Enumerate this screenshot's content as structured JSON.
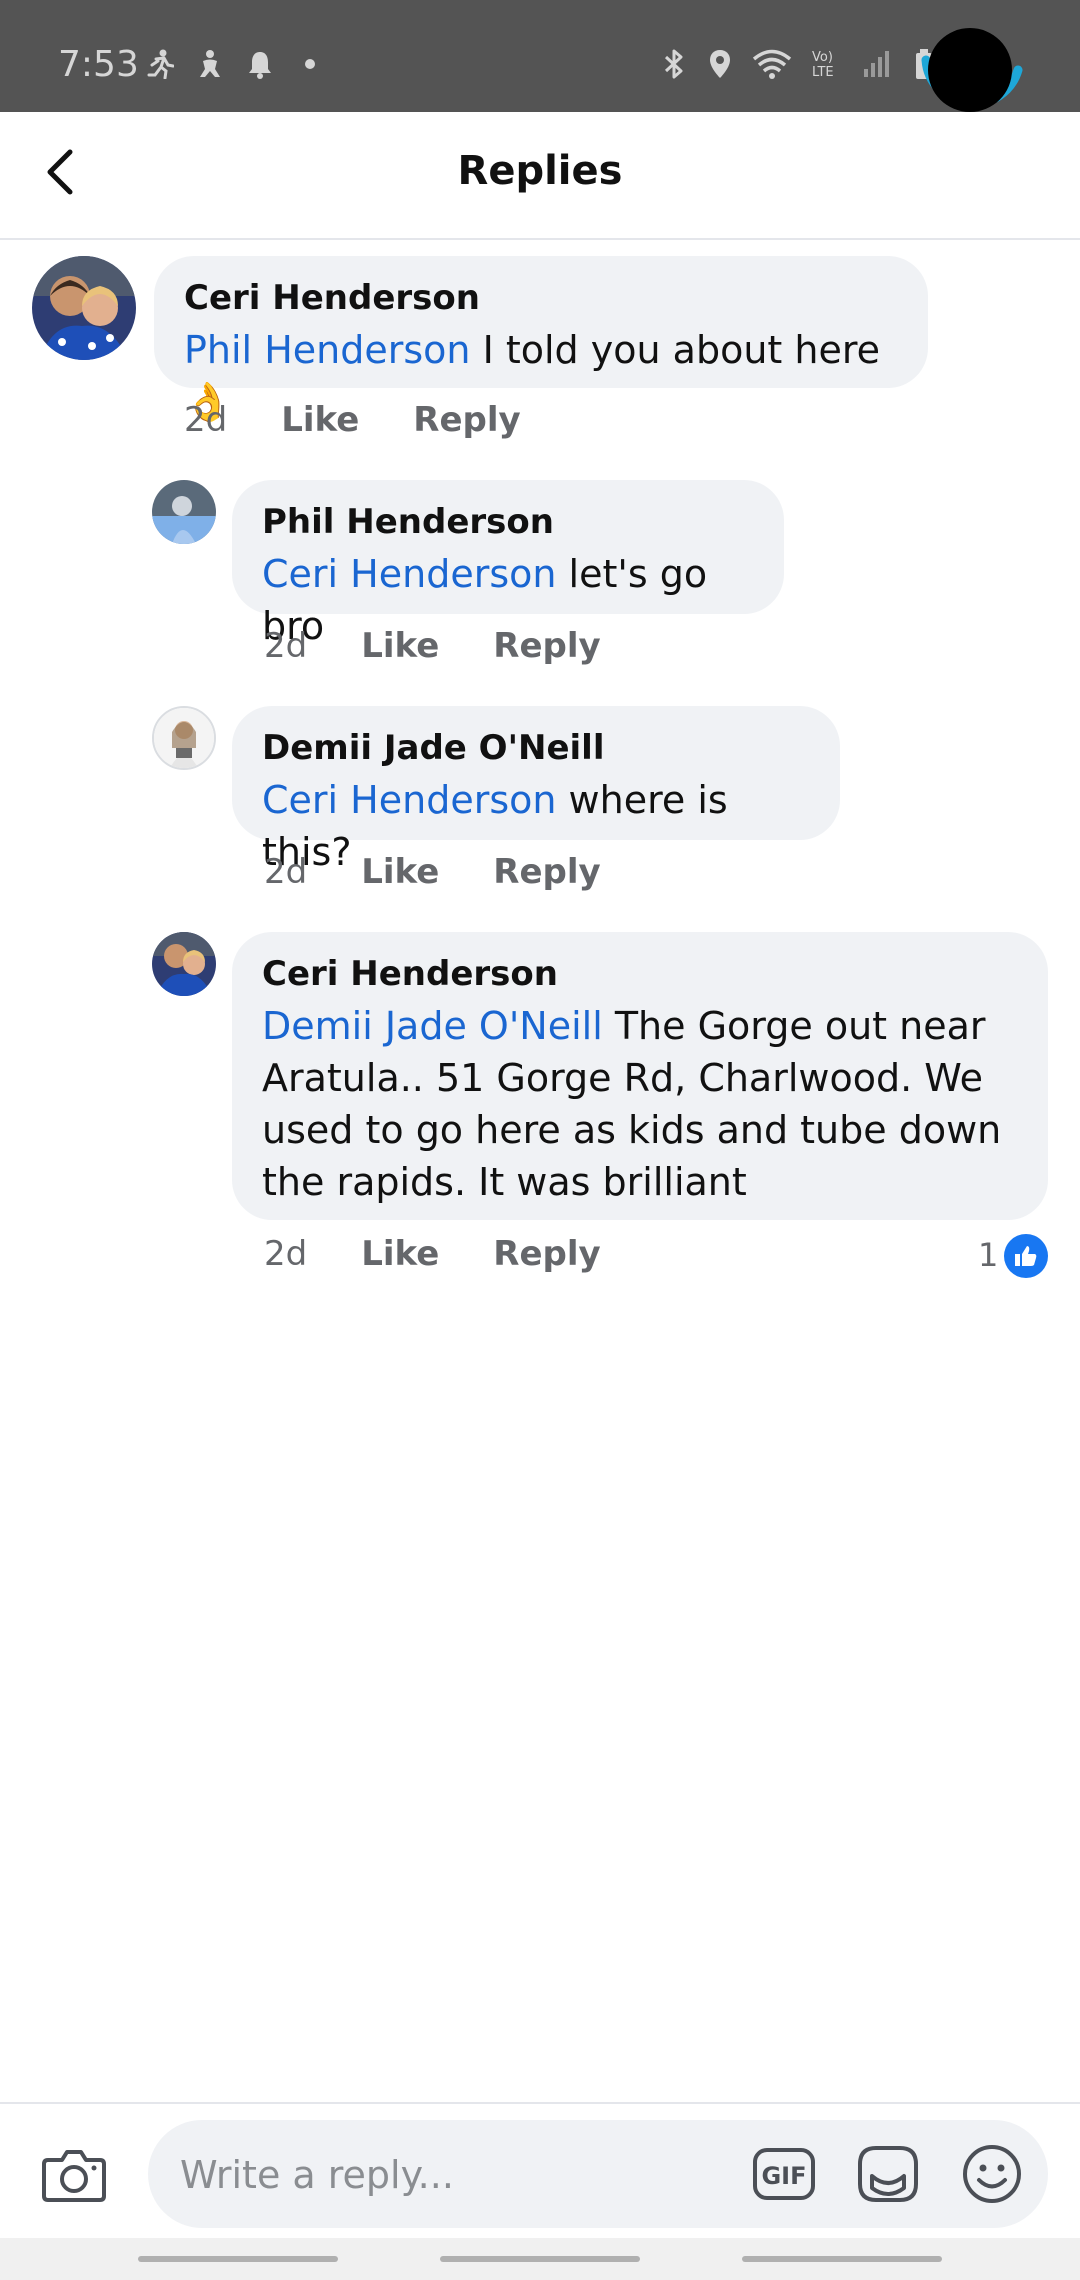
{
  "status_bar": {
    "time": "7:53",
    "left_icons": [
      "running-icon",
      "accessibility-icon",
      "notification-bell-icon",
      "dot-icon"
    ],
    "right_icons": [
      "bluetooth-icon",
      "location-icon",
      "wifi-icon",
      "volte-icon",
      "signal-icon",
      "battery-icon"
    ],
    "volte_label": "Vo)\nLTE"
  },
  "header": {
    "title": "Replies",
    "back_icon": "chevron-left-icon"
  },
  "comments": [
    {
      "author": "Ceri Henderson",
      "mention": "Phil Henderson",
      "text": " I told you about here 👌",
      "time": "2d",
      "like_label": "Like",
      "reply_label": "Reply"
    },
    {
      "author": "Phil Henderson",
      "mention": "Ceri Henderson",
      "text": " let's go bro",
      "time": "2d",
      "like_label": "Like",
      "reply_label": "Reply"
    },
    {
      "author": "Demii Jade O'Neill",
      "mention": "Ceri Henderson",
      "text": " where is this?",
      "time": "2d",
      "like_label": "Like",
      "reply_label": "Reply"
    },
    {
      "author": "Ceri Henderson",
      "mention": "Demii Jade O'Neill",
      "text": "  The Gorge out near Aratula.. 51 Gorge Rd, Charlwood. We used to go here as kids and tube down the rapids. It was brilliant",
      "time": "2d",
      "like_label": "Like",
      "reply_label": "Reply",
      "like_count": "1"
    }
  ],
  "composer": {
    "placeholder": "Write a reply...",
    "gif_label": "GIF",
    "icons": [
      "camera-icon",
      "gif-icon",
      "sticker-icon",
      "emoji-icon"
    ]
  },
  "colors": {
    "mention": "#1a66d1",
    "bubble": "#f0f2f5",
    "like_badge": "#1877f2",
    "status_bar": "#545454"
  }
}
